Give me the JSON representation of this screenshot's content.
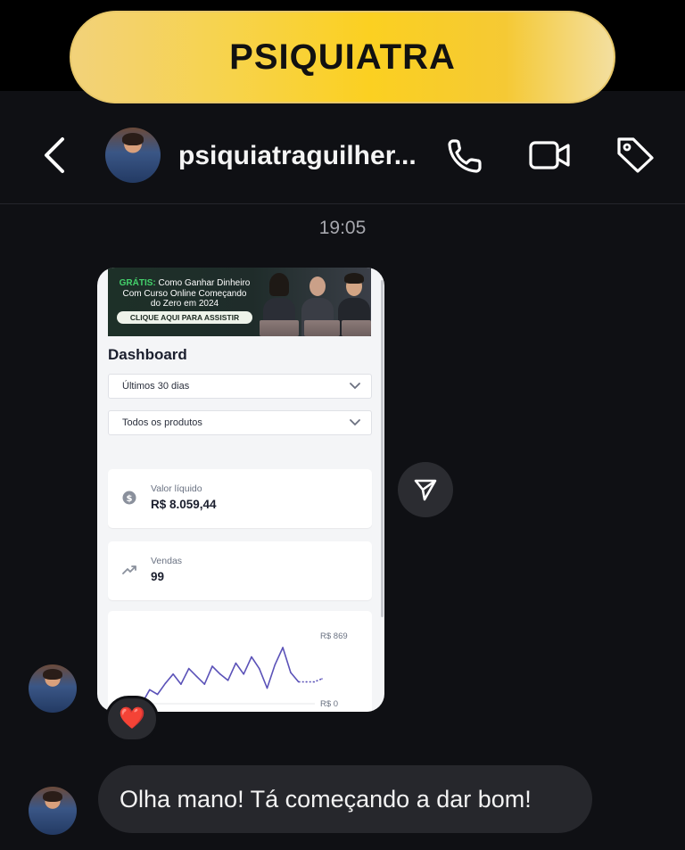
{
  "banner": {
    "label": "PSIQUIATRA"
  },
  "header": {
    "username": "psiquiatraguilher..."
  },
  "thread": {
    "timestamp": "19:05",
    "shared_post": {
      "ad": {
        "free_label": "GRÁTIS:",
        "headline_1": " Como Ganhar Dinheiro",
        "headline_2": "Com Curso Online Começando",
        "headline_3": "do Zero em 2024",
        "cta": "CLIQUE AQUI PARA ASSISTIR"
      },
      "dashboard": {
        "title": "Dashboard",
        "period_select": "Últimos 30 dias",
        "product_select": "Todos os produtos",
        "net_value_label": "Valor líquido",
        "net_value": "R$ 8.059,44",
        "sales_label": "Vendas",
        "sales_value": "99"
      }
    },
    "reaction": "❤️",
    "message": "Olha mano! Tá começando a dar bom!"
  },
  "chart_data": {
    "type": "line",
    "title": "",
    "ymax_label": "R$ 869",
    "ymin_label": "R$ 0",
    "ylim": [
      0,
      869
    ],
    "x": [
      1,
      2,
      3,
      4,
      5,
      6,
      7,
      8,
      9,
      10,
      11,
      12,
      13,
      14,
      15,
      16,
      17,
      18,
      19,
      20,
      21,
      22,
      23,
      24
    ],
    "values": [
      0,
      180,
      120,
      260,
      380,
      250,
      450,
      350,
      250,
      480,
      380,
      300,
      520,
      380,
      600,
      450,
      200,
      500,
      720,
      400,
      280,
      280,
      280,
      320
    ],
    "color": "#5b52b8"
  }
}
